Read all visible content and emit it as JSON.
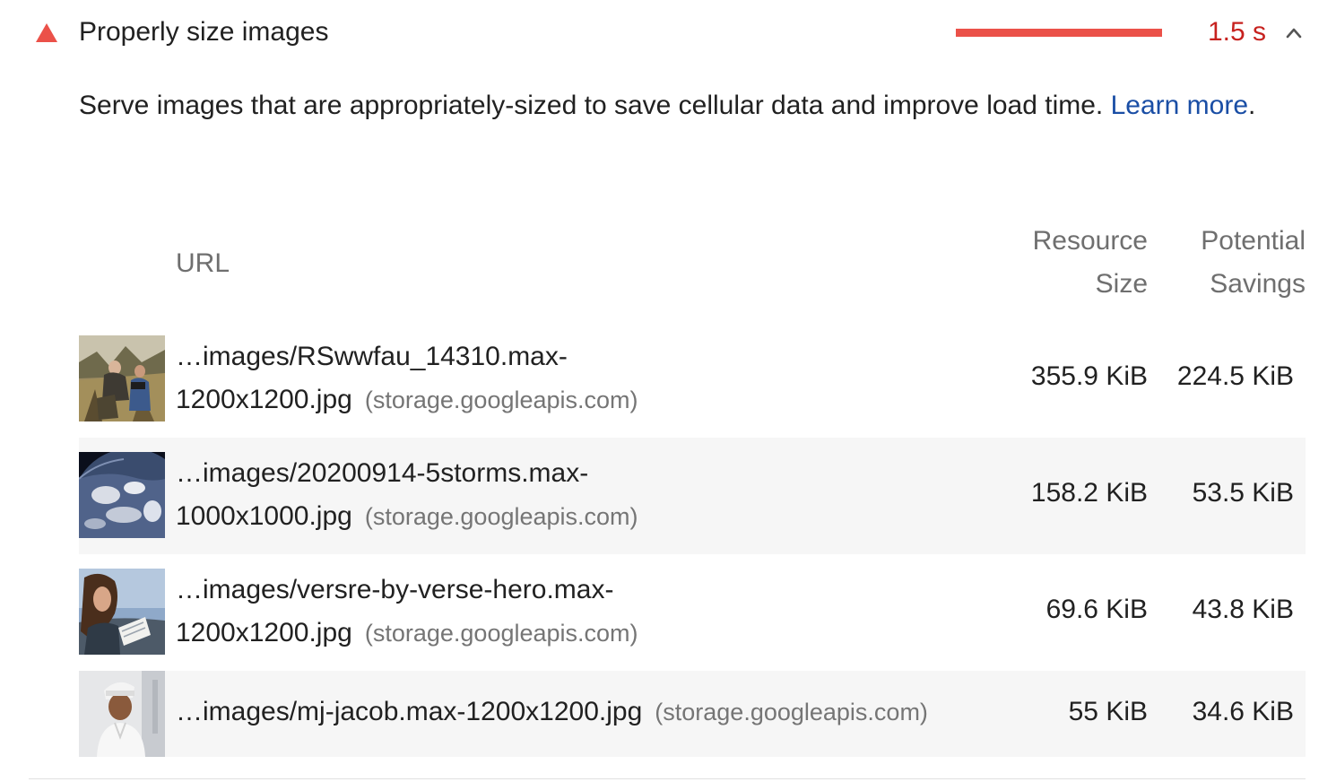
{
  "audit": {
    "title": "Properly size images",
    "metric": "1.5 s",
    "description": "Serve images that are appropriately-sized to save cellular data and improve load time. ",
    "learn_more": "Learn more",
    "learn_more_suffix": ".",
    "status": "fail",
    "colors": {
      "fail": "#eb5149",
      "fail_text": "#c7221f",
      "link": "#1a4ea5"
    }
  },
  "table": {
    "headers": {
      "url": "URL",
      "size_line1": "Resource",
      "size_line2": "Size",
      "savings_line1": "Potential",
      "savings_line2": "Savings"
    },
    "rows": [
      {
        "url_line1": "…images/RSwwfau_14310.max-",
        "url_line2": "1200x1200.jpg",
        "origin": "(storage.googleapis.com)",
        "size": "355.9 KiB",
        "savings": "224.5 KiB",
        "thumbnail": "field-researchers-photo"
      },
      {
        "url_line1": "…images/20200914-5storms.max-",
        "url_line2": "1000x1000.jpg",
        "origin": "(storage.googleapis.com)",
        "size": "158.2 KiB",
        "savings": "53.5 KiB",
        "thumbnail": "earth-storms-satellite-photo"
      },
      {
        "url_line1": "…images/versre-by-verse-hero.max-",
        "url_line2": "1200x1200.jpg",
        "origin": "(storage.googleapis.com)",
        "size": "69.6 KiB",
        "savings": "43.8 KiB",
        "thumbnail": "woman-reading-photo"
      },
      {
        "url_line1": "…images/mj-jacob.max-1200x1200.jpg",
        "url_line2": "",
        "origin": "(storage.googleapis.com)",
        "size": "55 KiB",
        "savings": "34.6 KiB",
        "thumbnail": "man-portrait-photo"
      }
    ]
  }
}
